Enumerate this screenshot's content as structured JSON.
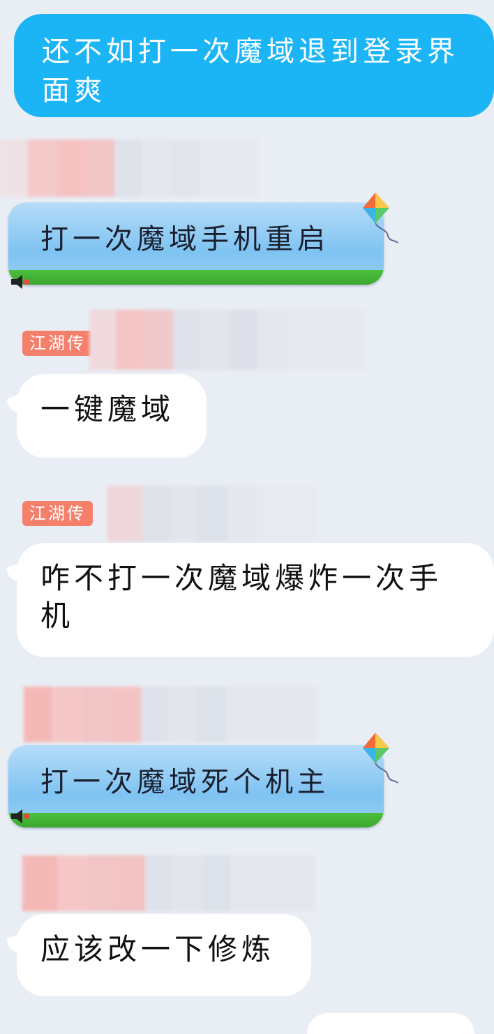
{
  "messages": [
    {
      "text": "还不如打一次魔域退到登录界面爽"
    },
    {
      "text": "打一次魔域手机重启"
    },
    {
      "sender_tag": "江湖传",
      "text": "一键魔域"
    },
    {
      "sender_tag": "江湖传",
      "text": "咋不打一次魔域爆炸一次手机"
    },
    {
      "text": "打一次魔域死个机主"
    },
    {
      "text": "应该改一下修炼"
    }
  ],
  "colors": {
    "blue_bubble": "#1bb5f6",
    "tag_bg": "#f4806c",
    "background": "#e9edf4"
  },
  "icons": [
    "kite-icon",
    "speaker-icon"
  ]
}
